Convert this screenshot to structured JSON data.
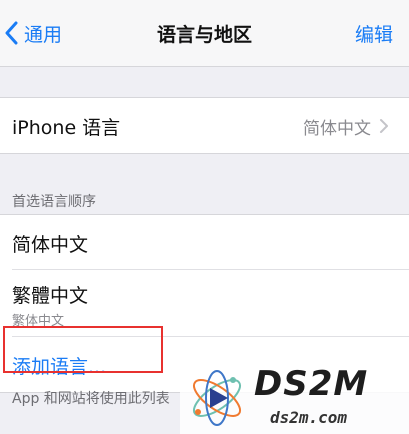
{
  "navbar": {
    "back_label": "通用",
    "title": "语言与地区",
    "edit_label": "编辑"
  },
  "iphone_language": {
    "label": "iPhone 语言",
    "value": "简体中文"
  },
  "preferred_section": {
    "header": "首选语言顺序",
    "languages": [
      {
        "name": "简体中文"
      },
      {
        "name": "繁體中文",
        "subtitle": "繁体中文"
      }
    ],
    "add_label": "添加语言..."
  },
  "footer": {
    "text": "App 和网站将使用此列表"
  },
  "watermark": {
    "title": "DS2M",
    "url": "ds2m.com"
  },
  "colors": {
    "accent": "#1a7cf5",
    "highlight_border": "#e8312f",
    "background": "#efeff4"
  }
}
